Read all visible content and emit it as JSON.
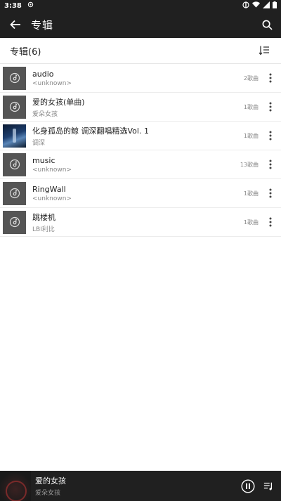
{
  "status": {
    "time": "3:38",
    "icons": [
      "signal-icon",
      "wifi-icon",
      "battery-icon"
    ]
  },
  "appbar": {
    "title": "专辑"
  },
  "subheader": {
    "label": "专辑(6)"
  },
  "albums": [
    {
      "title": "audio",
      "artist": "<unknown>",
      "count": "2歌曲",
      "art": "default"
    },
    {
      "title": "爱的女孩(单曲)",
      "artist": "爱朵女孩",
      "count": "1歌曲",
      "art": "default"
    },
    {
      "title": "化身孤岛的鲸 调深翻唱精选Vol. 1",
      "artist": "调深",
      "count": "1歌曲",
      "art": "image"
    },
    {
      "title": "music",
      "artist": "<unknown>",
      "count": "13歌曲",
      "art": "default"
    },
    {
      "title": "RingWall",
      "artist": "<unknown>",
      "count": "1歌曲",
      "art": "default"
    },
    {
      "title": "跳楼机",
      "artist": "LBI利比",
      "count": "1歌曲",
      "art": "default"
    }
  ],
  "player": {
    "title": "爱的女孩",
    "artist": "爱朵女孩"
  },
  "colors": {
    "bar": "#202020",
    "background": "#ffffff",
    "thumb": "#555555"
  }
}
